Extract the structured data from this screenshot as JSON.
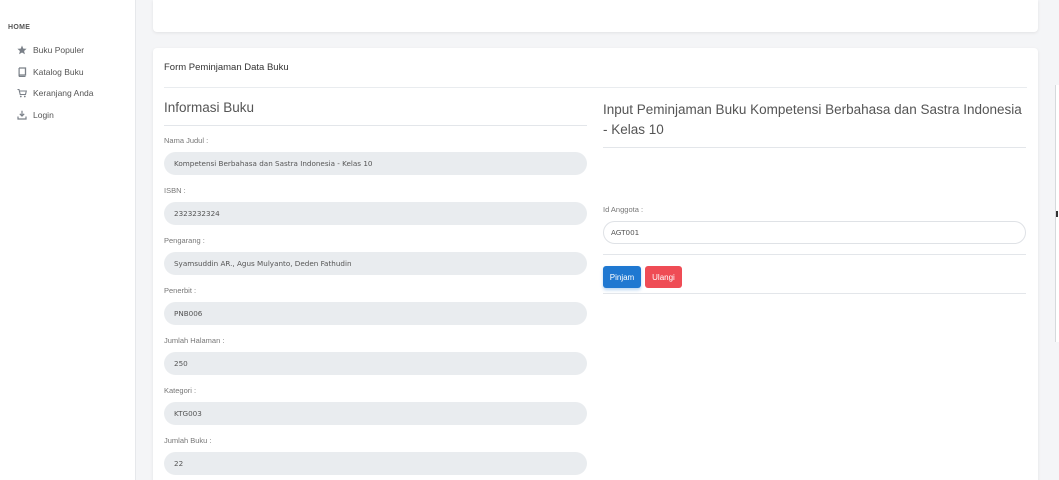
{
  "sidebar": {
    "heading": "HOME",
    "items": [
      {
        "label": "Buku Populer",
        "icon": "star-icon"
      },
      {
        "label": "Katalog Buku",
        "icon": "book-icon"
      },
      {
        "label": "Keranjang Anda",
        "icon": "cart-icon"
      },
      {
        "label": "Login",
        "icon": "download-icon"
      }
    ]
  },
  "card": {
    "title": "Form Peminjaman Data Buku"
  },
  "info": {
    "title": "Informasi Buku",
    "fields": [
      {
        "label": "Nama Judul :",
        "value": "Kompetensi Berbahasa dan Sastra Indonesia - Kelas 10"
      },
      {
        "label": "ISBN :",
        "value": "2323232324"
      },
      {
        "label": "Pengarang :",
        "value": "Syamsuddin AR., Agus Mulyanto, Deden Fathudin"
      },
      {
        "label": "Penerbit :",
        "value": "PNB006"
      },
      {
        "label": "Jumlah Halaman :",
        "value": "250"
      },
      {
        "label": "Kategori :",
        "value": "KTG003"
      },
      {
        "label": "Jumlah Buku :",
        "value": "22"
      }
    ]
  },
  "input": {
    "title": "Input Peminjaman Buku Kompetensi Berbahasa dan Sastra Indonesia - Kelas 10",
    "label": "Id Anggota :",
    "value": "AGT001"
  },
  "buttons": {
    "submit": "Pinjam",
    "reset": "Ulangi"
  },
  "colors": {
    "primary": "#1f78d1",
    "danger": "#ef4c55",
    "readonly_field": "#e9ecef"
  }
}
